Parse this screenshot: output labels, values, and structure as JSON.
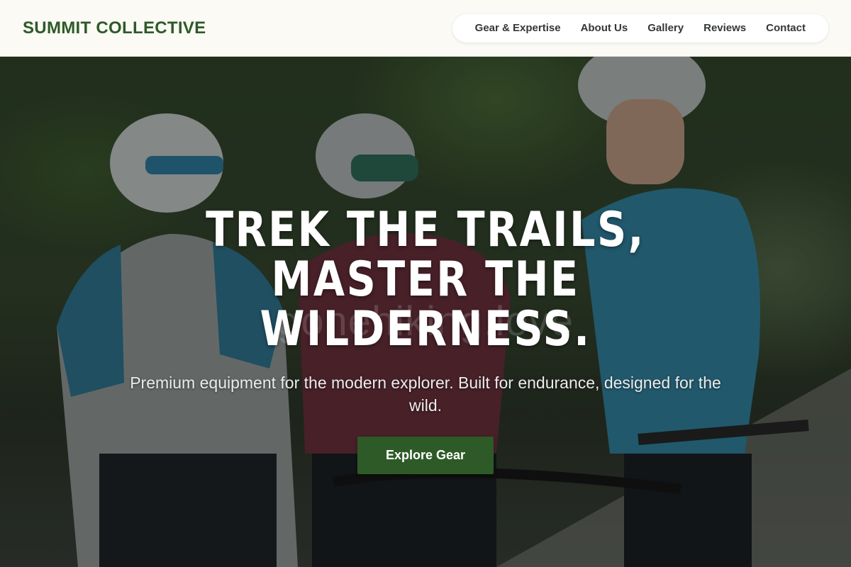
{
  "header": {
    "logo": "SUMMIT COLLECTIVE",
    "nav": [
      {
        "label": "Gear & Expertise"
      },
      {
        "label": "About Us"
      },
      {
        "label": "Gallery"
      },
      {
        "label": "Reviews"
      },
      {
        "label": "Contact"
      }
    ]
  },
  "hero": {
    "title": "TREK THE TRAILS, MASTER THE WILDERNESS.",
    "subtitle": "Premium equipment for the modern explorer. Built for endurance, designed for the wild.",
    "cta_label": "Explore Gear",
    "watermark": "gonehiking.love",
    "image_alt": "cyclists"
  },
  "colors": {
    "brand_green": "#2e5a27",
    "header_bg": "#fbfaf5",
    "text_white": "#ffffff"
  }
}
